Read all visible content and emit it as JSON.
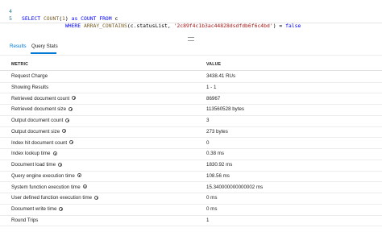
{
  "editor": {
    "lines": [
      {
        "num": "4",
        "parts": [
          [
            "kw",
            "SELECT "
          ],
          [
            "fn",
            "COUNT"
          ],
          [
            "pl",
            "("
          ],
          [
            "fn",
            "1"
          ],
          [
            "pl",
            ") "
          ],
          [
            "kw",
            "as COUNT FROM "
          ],
          [
            "pl",
            "c"
          ]
        ]
      },
      {
        "num": "5",
        "parts": [
          [
            "pl",
            "              "
          ],
          [
            "kw",
            "WHERE "
          ],
          [
            "fn",
            "ARRAY_CONTAINS"
          ],
          [
            "pl",
            "(c.statusList, "
          ],
          [
            "str",
            "'2c89f4c1b3ac44828dsdfdb6f6c4bd'"
          ],
          [
            "pl",
            ") = "
          ],
          [
            "kw",
            "false"
          ]
        ]
      }
    ]
  },
  "tabs": {
    "results_label": "Results",
    "stats_label": "Query Stats"
  },
  "table": {
    "header_metric": "METRIC",
    "header_value": "VALUE",
    "rows": [
      {
        "metric": "Request Charge",
        "value": "3438.41 RUs",
        "info": false
      },
      {
        "metric": "Showing Results",
        "value": "1 - 1",
        "info": false
      },
      {
        "metric": "Retrieved document count",
        "value": "86967",
        "info": true
      },
      {
        "metric": "Retrieved document size",
        "value": "113560528 bytes",
        "info": true
      },
      {
        "metric": "Output document count",
        "value": "3",
        "info": true
      },
      {
        "metric": "Output document size",
        "value": "273 bytes",
        "info": true
      },
      {
        "metric": "Index hit document count",
        "value": "0",
        "info": true
      },
      {
        "metric": "Index lookup time",
        "value": "0.38 ms",
        "info": true
      },
      {
        "metric": "Document load time",
        "value": "1830.92 ms",
        "info": true
      },
      {
        "metric": "Query engine execution time",
        "value": "108.56 ms",
        "info": true
      },
      {
        "metric": "System function execution time",
        "value": "15.340000000000002 ms",
        "info": true
      },
      {
        "metric": "User defined function execution time",
        "value": "0 ms",
        "info": true
      },
      {
        "metric": "Document write time",
        "value": "0 ms",
        "info": true
      },
      {
        "metric": "Round Trips",
        "value": "1",
        "info": false
      }
    ]
  }
}
